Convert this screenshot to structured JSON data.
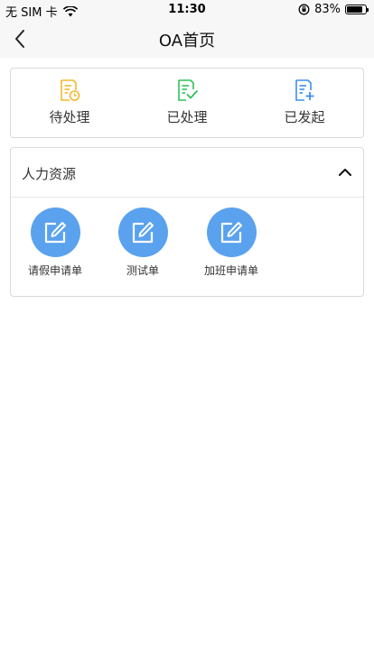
{
  "status_bar": {
    "carrier": "无 SIM 卡",
    "time": "11:30",
    "battery_percent": "83%",
    "battery_level": 0.83,
    "icons": [
      "wifi-icon",
      "orientation-lock-icon",
      "battery-icon"
    ]
  },
  "nav": {
    "title": "OA首页",
    "back_icon": "chevron-left-icon"
  },
  "status_tabs": [
    {
      "label": "待处理",
      "icon": "document-clock-icon",
      "color": "#f5b82e"
    },
    {
      "label": "已处理",
      "icon": "document-check-icon",
      "color": "#2ec15a"
    },
    {
      "label": "已发起",
      "icon": "document-plus-icon",
      "color": "#3d8ef0"
    }
  ],
  "hr_section": {
    "title": "人力资源",
    "chevron_icon": "chevron-up-icon",
    "apps": [
      {
        "label": "请假申请单",
        "icon": "edit-icon"
      },
      {
        "label": "测试单",
        "icon": "edit-icon"
      },
      {
        "label": "加班申请单",
        "icon": "edit-icon"
      }
    ],
    "app_color": "#5aa2ee"
  }
}
